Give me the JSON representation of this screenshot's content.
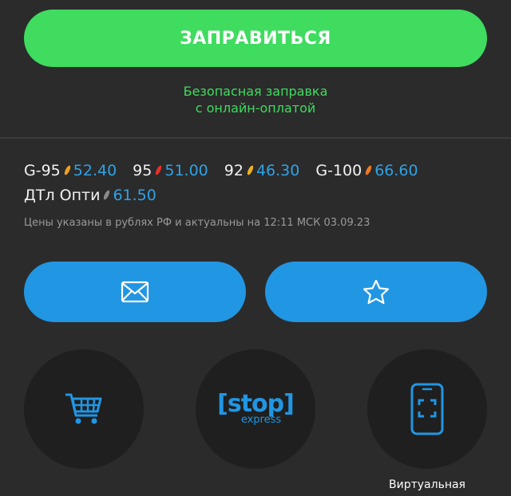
{
  "refuel": {
    "button_label": "ЗАПРАВИТЬСЯ",
    "subtitle_line1": "Безопасная заправка",
    "subtitle_line2": "с онлайн-оплатой"
  },
  "prices": {
    "row1": [
      {
        "fuel": "G-95",
        "price": "52.40",
        "drop_color": "#f0a020"
      },
      {
        "fuel": "95",
        "price": "51.00",
        "drop_color": "#e8302a"
      },
      {
        "fuel": "92",
        "price": "46.30",
        "drop_color": "#f0b020"
      },
      {
        "fuel": "G-100",
        "price": "66.60",
        "drop_color": "#f07a20"
      }
    ],
    "row2": [
      {
        "fuel": "ДТл Опти",
        "price": "61.50",
        "drop_color": "#8a8a8a"
      }
    ],
    "note": "Цены указаны в рублях РФ и актуальны на 12:11 МСК 03.09.23"
  },
  "actions": {
    "mail_icon": "envelope-icon",
    "favorite_icon": "star-icon"
  },
  "services": {
    "cart_icon": "shopping-cart-icon",
    "stop_logo_main": "[stop]",
    "stop_logo_sub": "express",
    "virtual_card_icon": "phone-scan-icon",
    "virtual_card_label": "Виртуальная"
  },
  "colors": {
    "accent_green": "#3fdc5f",
    "accent_blue": "#2196e3",
    "background": "#2b2b2b",
    "circle_bg": "#1f1f1f"
  }
}
